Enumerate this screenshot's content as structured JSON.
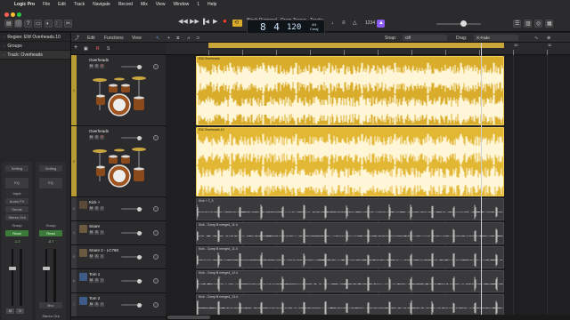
{
  "menu": {
    "app": "Logic Pro",
    "items": [
      "File",
      "Edit",
      "Track",
      "Navigate",
      "Record",
      "Mix",
      "View",
      "Window",
      "1",
      "Help"
    ]
  },
  "window_title": "Black Diamond - Drum Teaser - Tracks",
  "lcd": {
    "bar": "8",
    "beat": "4",
    "tempo": "120",
    "time_sig": "4/4",
    "key": "Cmaj"
  },
  "colors": {
    "drummer": "#d9ad2b",
    "audio_region": "#3a3a3c",
    "accent": "#8a5cf5"
  },
  "inspector": {
    "region": "Region: EW Overheads.10",
    "groups": "Groups",
    "track": "Track: Overheads",
    "strip1": {
      "setting": "Setting",
      "eq": "EQ",
      "input": "Input",
      "audio_fx": "Audio FX",
      "sends": "Sends",
      "output": "Stereo Out",
      "group": "Group",
      "automation": "Read",
      "value": "0,0",
      "pan": "-1.2",
      "mute": "M",
      "solo": "S",
      "name": ""
    },
    "strip2": {
      "setting": "Setting",
      "eq": "EQ",
      "output": "",
      "group": "Group",
      "automation": "Read",
      "value": "0,0",
      "pan": "-8.7",
      "mute": "M",
      "solo": "S",
      "name": "Stereo Out",
      "bnc": "Bnc"
    }
  },
  "arrange_toolbar": {
    "edit": "Edit",
    "functions": "Functions",
    "view": "View",
    "snap_label": "Snap:",
    "snap_value": "Off",
    "drag_label": "Drag:",
    "drag_value": "X-Fade"
  },
  "ruler_numbers": [
    "1",
    "2",
    "3",
    "4",
    "5",
    "6",
    "7",
    "8",
    "9",
    "10",
    "11"
  ],
  "tracks": [
    {
      "number": "1",
      "name": "Overheads",
      "type": "drummer"
    },
    {
      "number": "2",
      "name": "Overheads",
      "type": "drummer"
    },
    {
      "number": "3",
      "name": "Kick +",
      "type": "audio"
    },
    {
      "number": "4",
      "name": "Snare",
      "type": "audio"
    },
    {
      "number": "5",
      "name": "Snare 2 - LC760",
      "type": "audio"
    },
    {
      "number": "6",
      "name": "Tom 1",
      "type": "audio"
    },
    {
      "number": "7",
      "name": "Tom 2",
      "type": "audio"
    }
  ],
  "regions": [
    {
      "name": "EW Overheads",
      "track": 0
    },
    {
      "name": "EW Overheads.10",
      "track": 1
    },
    {
      "name": "Kick + 2_3",
      "track": 2
    },
    {
      "name": "Kick - Comp B merged_11.4",
      "track": 3
    },
    {
      "name": "Kick - Comp B merged_11.4",
      "track": 4
    },
    {
      "name": "Kick - Comp B merged_12.4",
      "track": 5
    },
    {
      "name": "Kick - Comp B merged_13.4",
      "track": 6
    }
  ],
  "msr": {
    "m": "M",
    "s": "S",
    "r": "R",
    "i": "I"
  }
}
